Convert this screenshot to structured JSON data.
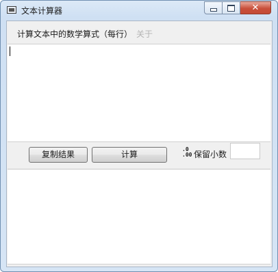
{
  "window": {
    "title": "文本计算器",
    "controls": {
      "minimize": "minimize",
      "maximize": "maximize",
      "close": "✕"
    }
  },
  "menu": {
    "label": "计算文本中的数学算式（每行）",
    "about": "关于"
  },
  "input_area": {
    "value": ""
  },
  "toolbar": {
    "copy_result_label": "复制结果",
    "calculate_label": "计算",
    "decimal_icon": ".0 .00",
    "decimal_label": "保留小数",
    "decimal_value": ""
  },
  "output_area": {
    "value": ""
  },
  "colors": {
    "title_bar": "#d6e5f5",
    "close_button": "#c9503b",
    "client_bg": "#f0f0f0",
    "disabled_text": "#b4b4b4"
  }
}
